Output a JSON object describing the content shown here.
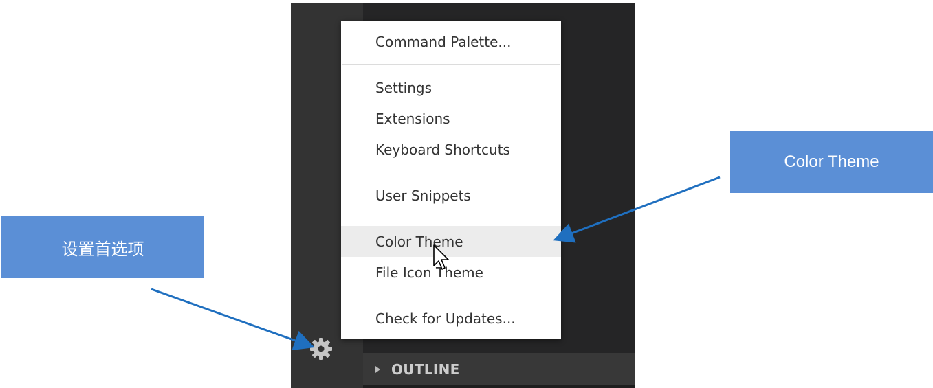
{
  "callouts": {
    "preferences_label": "设置首选项",
    "color_theme_label": "Color Theme"
  },
  "menu": {
    "items": [
      {
        "label": "Command Palette..."
      },
      {
        "label": "Settings"
      },
      {
        "label": "Extensions"
      },
      {
        "label": "Keyboard Shortcuts"
      },
      {
        "label": "User Snippets"
      },
      {
        "label": "Color Theme"
      },
      {
        "label": "File Icon Theme"
      },
      {
        "label": "Check for Updates..."
      }
    ],
    "hovered": "Color Theme"
  },
  "sidebar": {
    "outline_label": "OUTLINE"
  },
  "icons": {
    "gear": "gear-icon",
    "chevron": "chevron-right-icon",
    "cursor": "mouse-cursor-icon"
  },
  "colors": {
    "callout_bg": "#5b8fd6",
    "arrow": "#1f6fbf",
    "activity_bar": "#333333",
    "sidebar": "#252526",
    "menu_hover": "#ececec"
  }
}
